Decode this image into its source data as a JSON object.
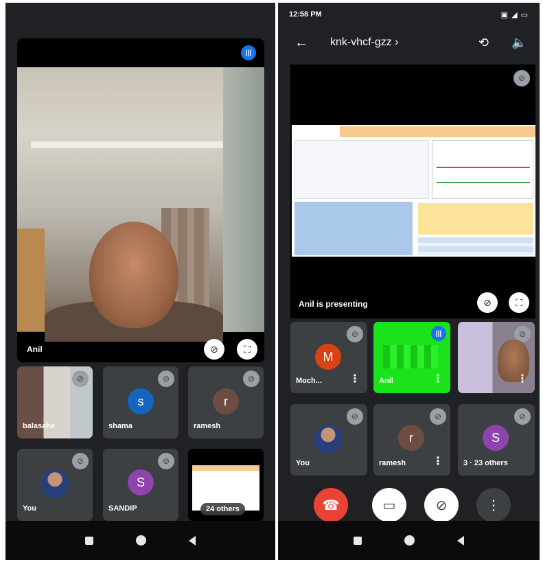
{
  "left_phone": {
    "main_tile": {
      "name": "Anil",
      "speaking_icon": "audio-wave-icon"
    },
    "tiles": [
      {
        "name": "balasahe",
        "type": "video"
      },
      {
        "name": "shama",
        "type": "initial",
        "initial": "s",
        "color": "#1565c0"
      },
      {
        "name": "ramesh",
        "type": "initial",
        "initial": "r",
        "color": "#6d4c41"
      },
      {
        "name": "You",
        "type": "photo"
      },
      {
        "name": "SANDIP",
        "type": "initial",
        "initial": "S",
        "color": "#8e44ad"
      },
      {
        "name": "24 others",
        "type": "others"
      }
    ]
  },
  "right_phone": {
    "status_time": "12:58 PM",
    "status_icons": "▣ ◢ ▭",
    "meeting_code": "knk-vhcf-gzz",
    "meeting_code_suffix": "›",
    "presenting_label": "Anil is presenting",
    "tiles": [
      {
        "name": "Moch...",
        "type": "initial",
        "initial": "M",
        "color": "#d84315"
      },
      {
        "name": "Anil",
        "type": "green"
      },
      {
        "name": "",
        "type": "video"
      },
      {
        "name": "You",
        "type": "photo"
      },
      {
        "name": "ramesh",
        "type": "initial",
        "initial": "r",
        "color": "#6d4c41"
      },
      {
        "name": "3 · 23 others",
        "type": "initial",
        "initial": "S",
        "color": "#8e44ad"
      }
    ],
    "controls": {
      "end_call": "end-call-icon",
      "camera": "camera-off-icon",
      "mic": "mic-off-icon",
      "more": "more-icon"
    }
  },
  "colors": {
    "end_call": "#ea4335",
    "accent": "#1a73e8",
    "tile_bg": "#3c4043",
    "bg": "#202124"
  }
}
